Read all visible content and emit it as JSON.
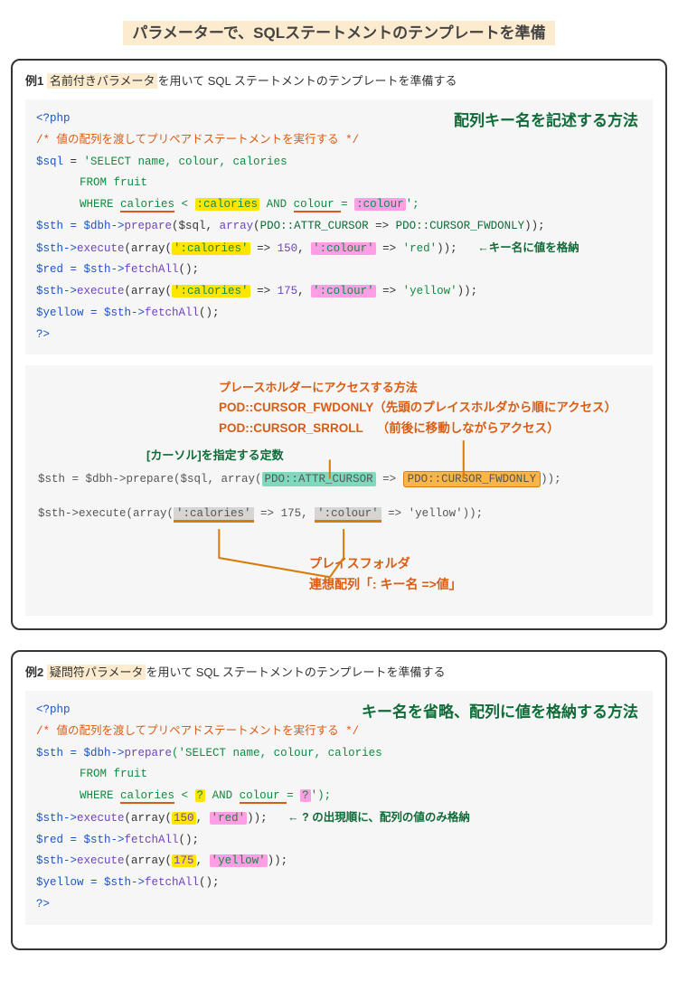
{
  "page_title": "パラメーターで、SQLステートメントのテンプレートを準備",
  "example1": {
    "label_prefix": "例1",
    "highlight": "名前付きパラメータ",
    "label_suffix": "を用いて SQL ステートメントのテンプレートを準備する",
    "method_note": "配列キー名を記述する方法",
    "php_open": "<?php",
    "comment": "/* 値の配列を渡してプリペアドステートメントを実行する */",
    "line_sql_assign": "$sql",
    "eq": " = ",
    "sql_select": "'SELECT name, colour, calories",
    "sql_from": "FROM fruit",
    "sql_where_pre": "WHERE ",
    "sql_calories": "calories",
    "sql_lt": " < ",
    "sql_ph_calories": ":calories",
    "sql_and": " AND ",
    "sql_colour": "colour ",
    "sql_eqs": "= ",
    "sql_ph_colour": ":colour",
    "sql_close": "';",
    "sth_assign": "$sth = $dbh->",
    "prepare": "prepare",
    "prepare_args_open": "($sql, ",
    "array_kw": "array",
    "attr_cursor": "PDO::ATTR_CURSOR",
    "arrow_assoc": " => ",
    "cursor_fwd": "PDO::CURSOR_FWDONLY",
    "paren_close": "));",
    "exec1_pre": "$sth->",
    "execute": "execute",
    "exec1_open": "(array(",
    "exec1_k1": "':calories'",
    "exec1_v1": "150",
    "exec1_k2": "':colour'",
    "exec1_v2": "'red'",
    "exec1_close": "));",
    "note_keyval": "←キー名に値を格納",
    "red_assign": "$red = $sth->",
    "fetchAll": "fetchAll",
    "call_close": "();",
    "exec2_v1": "175",
    "exec2_v2": "'yellow'",
    "yellow_assign": "$yellow = $sth->",
    "php_close": "?>"
  },
  "anno": {
    "h1": "プレースホルダーにアクセスする方法",
    "h2a": "POD::CURSOR_FWDONLY",
    "h2a_desc": "（先頭のプレイスホルダから順にアクセス）",
    "h2b": "POD::CURSOR_SRROLL",
    "h2b_desc": "（前後に移動しながらアクセス）",
    "sub": "[カーソル]を指定する定数",
    "code1_pre": "$sth = $dbh->prepare($sql, array(",
    "code1_attr": "PDO::ATTR_CURSOR",
    "code1_arrow": " => ",
    "code1_fwd": "PDO::CURSOR_FWDONLY",
    "code1_close": "));",
    "code2_pre": "$sth->execute(array(",
    "code2_k1": "':calories'",
    "code2_arrow": " => ",
    "code2_v1": "175",
    "code2_sep": ", ",
    "code2_k2": "':colour'",
    "code2_v2": "'yellow'",
    "code2_close": "));",
    "tail1": "プレイスフォルダ",
    "tail2": "連想配列「: キー名 =>値」"
  },
  "example2": {
    "label_prefix": "例2",
    "highlight": "疑問符パラメータ",
    "label_suffix": "を用いて SQL ステートメントのテンプレートを準備する",
    "method_note": "キー名を省略、配列に値を格納する方法",
    "php_open": "<?php",
    "comment": "/* 値の配列を渡してプリペアドステートメントを実行する */",
    "sth_assign": "$sth = $dbh->",
    "prepare": "prepare",
    "select_open": "('SELECT name, colour, calories",
    "from": "FROM fruit",
    "where_pre": "WHERE ",
    "calories": "calories",
    "lt": " < ",
    "qmark": "?",
    "and": " AND ",
    "colour": "colour ",
    "eqs": "= ",
    "close_str": "');",
    "exec1_pre": "$sth->",
    "execute": "execute",
    "exec1_open": "(array(",
    "exec1_v1": "150",
    "exec1_sep": ", ",
    "exec1_v2": "'red'",
    "exec1_close": "));",
    "note_order": "← ? の出現順に、配列の値のみ格納",
    "red_assign": "$red = $sth->",
    "fetchAll": "fetchAll",
    "call_close": "();",
    "exec2_v1": "175",
    "exec2_v2": "'yellow'",
    "yellow_assign": "$yellow = $sth->",
    "php_close": "?>"
  }
}
